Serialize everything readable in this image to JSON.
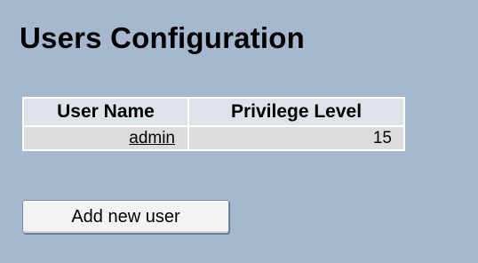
{
  "page": {
    "title": "Users Configuration"
  },
  "users_table": {
    "headers": {
      "user_name": "User Name",
      "privilege_level": "Privilege Level"
    },
    "rows": [
      {
        "user_name": "admin",
        "privilege_level": "15"
      }
    ]
  },
  "actions": {
    "add_user_label": "Add new user"
  },
  "colors": {
    "page_background": "#a5b8d0",
    "header_background": "#dee3e9",
    "row_background": "#dcdcdc"
  }
}
